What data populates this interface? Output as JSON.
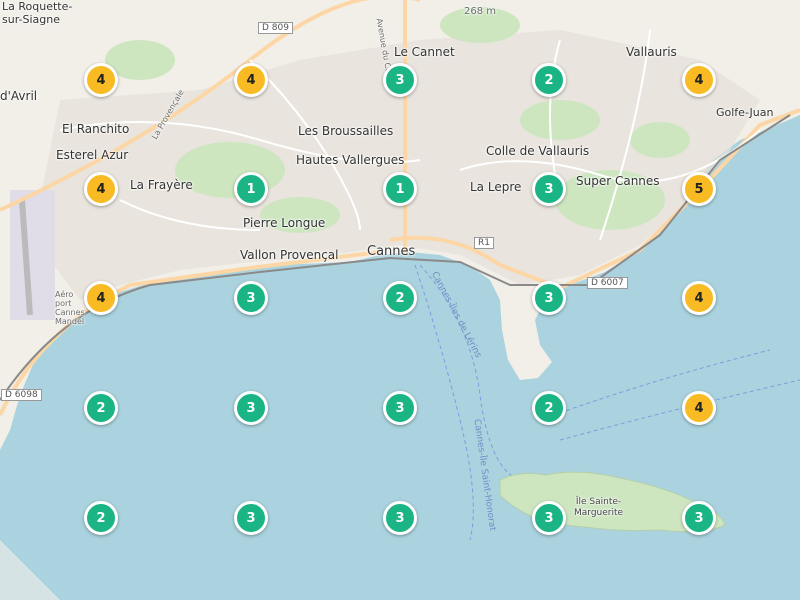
{
  "map": {
    "colors": {
      "sea": "#aad3df",
      "land": "#f2efe9",
      "urban": "#e6e1da",
      "green_area": "#cde6c0",
      "green_marker": "#1bb585",
      "yellow_marker": "#f8bb23",
      "main_road": "#fcd6a4",
      "minor_road": "#ffffff",
      "railway": "#8a8a8a",
      "ferry_route": "#7a9de0"
    },
    "places": {
      "la_roquette": "La Roquette-\nsur-Siagne",
      "dAvril": "d'Avril",
      "el_ranchito": "El Ranchito",
      "esterel_azur": "Esterel Azur",
      "la_frayere": "La Frayère",
      "le_cannet": "Le Cannet",
      "vallauris": "Vallauris",
      "golfe_juan": "Golfe-Juan",
      "les_broussailles": "Les Broussailles",
      "hautes_vallergues": "Hautes Vallergues",
      "colle_de_vallauris": "Colle de Vallauris",
      "la_lepre": "La Lepre",
      "super_cannes": "Super Cannes",
      "pierre_longue": "Pierre Longue",
      "vallon_provencal": "Vallon Provençal",
      "cannes": "Cannes",
      "ile_sainte_marguerite": "Île Sainte-\nMarguerite",
      "aeroport": "Aéro\nport\nCannes\nMandel",
      "elevation": "268 m"
    },
    "roads": {
      "d809": "D 809",
      "d6007": "D 6007",
      "d6098": "D 6098",
      "r1": "R1",
      "la_provencale": "La Provençale",
      "avenue_du_cannet": "Avenue du Ca...",
      "ferry_lerins": "Cannes-Îles de Lérins",
      "ferry_st_honorat": "Cannes-Île Saint-Honorat"
    },
    "markers": [
      {
        "count": "4",
        "color": "yellow"
      },
      {
        "count": "4",
        "color": "yellow"
      },
      {
        "count": "3",
        "color": "green"
      },
      {
        "count": "2",
        "color": "green"
      },
      {
        "count": "4",
        "color": "yellow"
      },
      {
        "count": "4",
        "color": "yellow"
      },
      {
        "count": "1",
        "color": "green"
      },
      {
        "count": "1",
        "color": "green"
      },
      {
        "count": "3",
        "color": "green"
      },
      {
        "count": "5",
        "color": "yellow"
      },
      {
        "count": "4",
        "color": "yellow"
      },
      {
        "count": "3",
        "color": "green"
      },
      {
        "count": "2",
        "color": "green"
      },
      {
        "count": "3",
        "color": "green"
      },
      {
        "count": "4",
        "color": "yellow"
      },
      {
        "count": "2",
        "color": "green"
      },
      {
        "count": "3",
        "color": "green"
      },
      {
        "count": "3",
        "color": "green"
      },
      {
        "count": "2",
        "color": "green"
      },
      {
        "count": "4",
        "color": "yellow"
      },
      {
        "count": "2",
        "color": "green"
      },
      {
        "count": "3",
        "color": "green"
      },
      {
        "count": "3",
        "color": "green"
      },
      {
        "count": "3",
        "color": "green"
      },
      {
        "count": "3",
        "color": "green"
      }
    ]
  }
}
